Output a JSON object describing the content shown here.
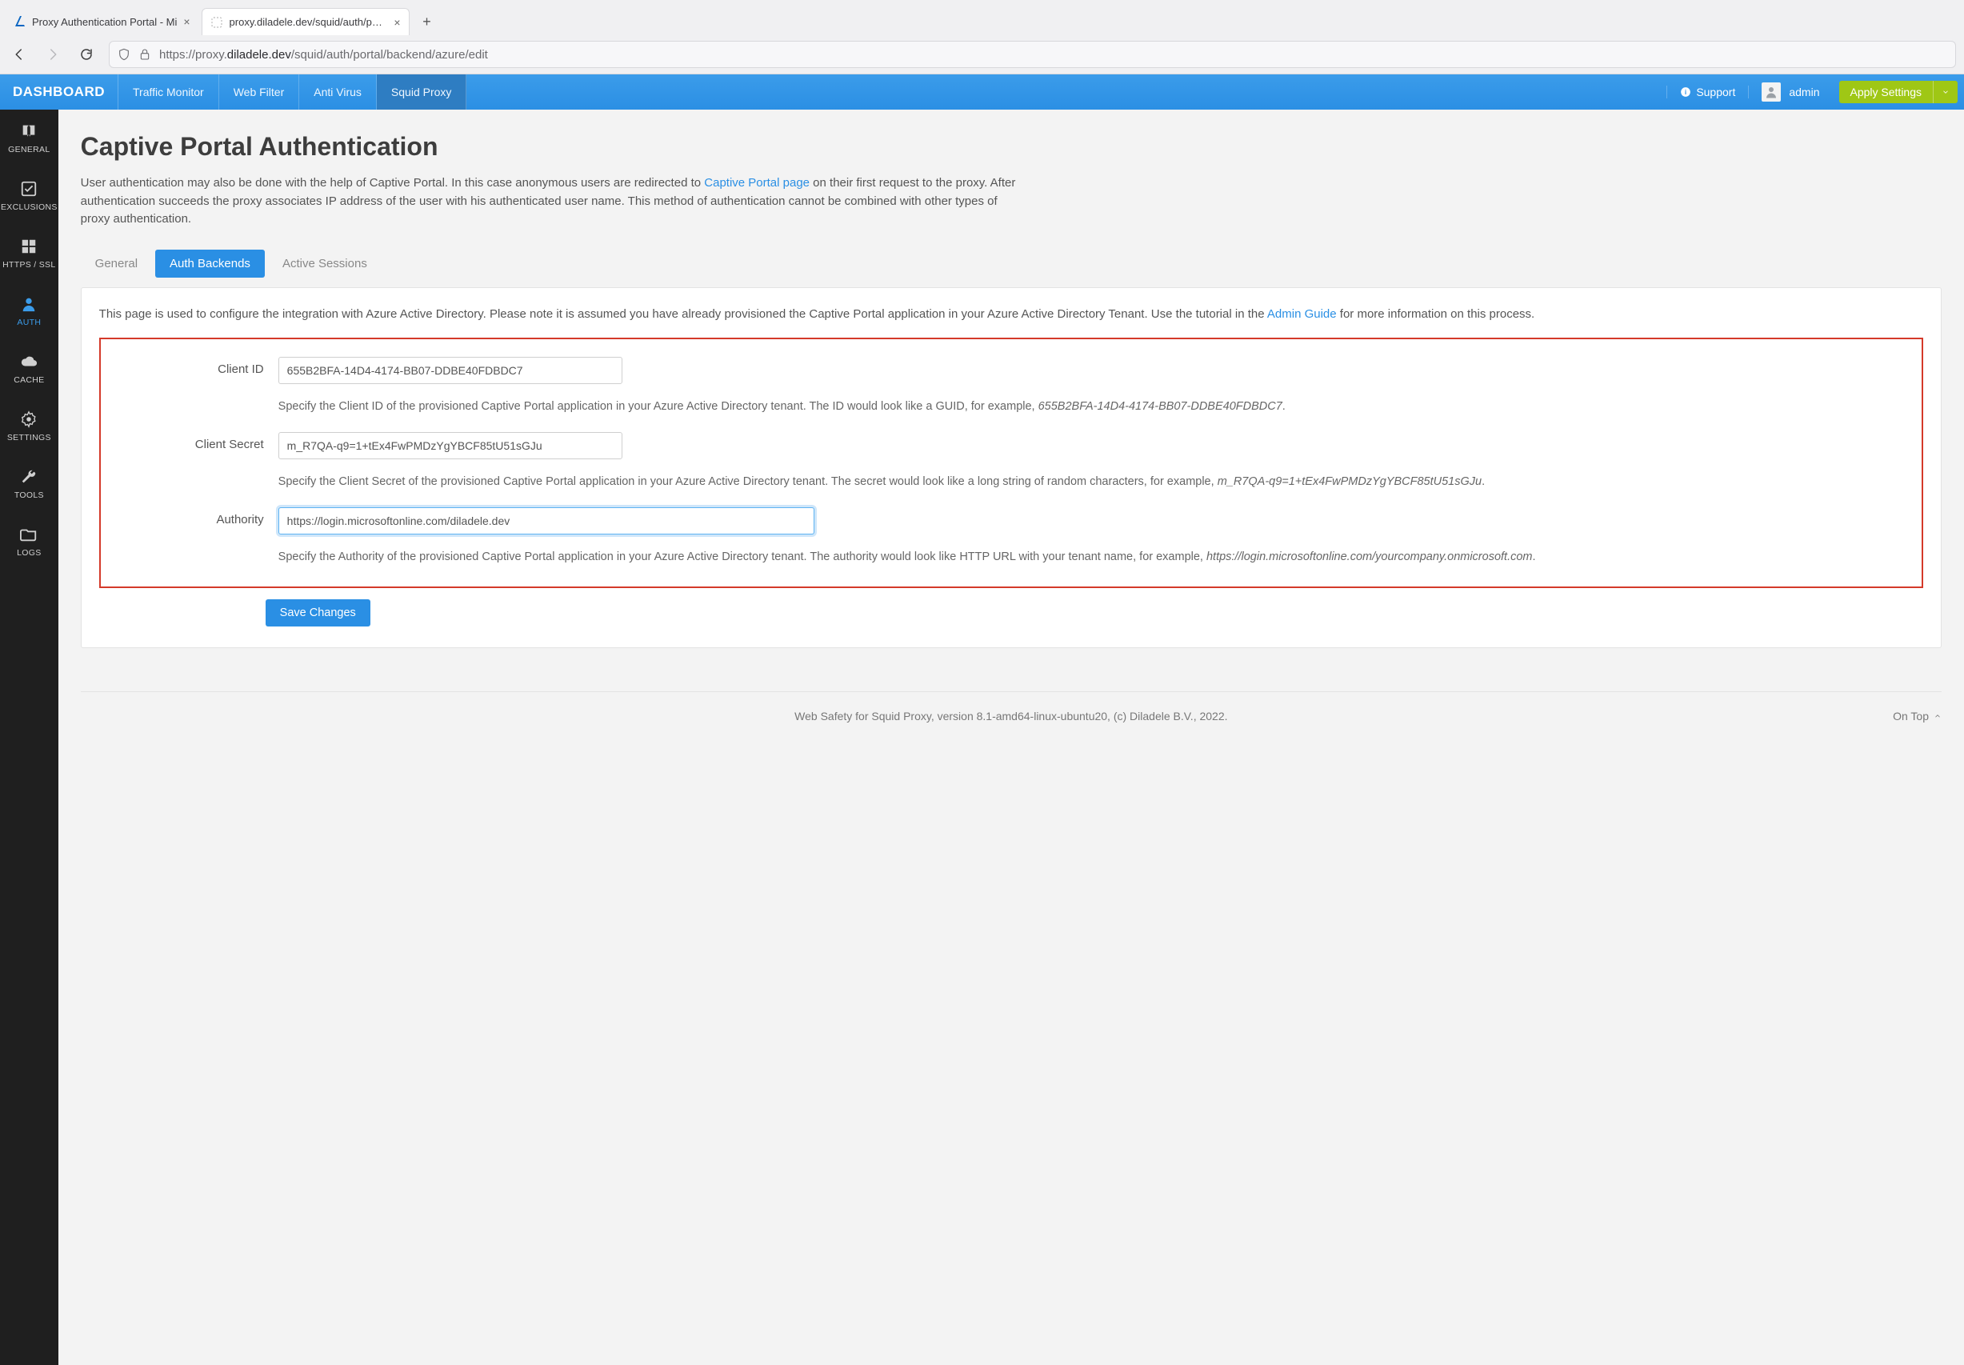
{
  "browser": {
    "tabs": [
      {
        "title": "Proxy Authentication Portal - Mi",
        "active": false,
        "fav": "azure"
      },
      {
        "title": "proxy.diladele.dev/squid/auth/porta",
        "active": true,
        "fav": "none"
      }
    ],
    "url_prefix": "https://proxy.",
    "url_host": "diladele.dev",
    "url_path": "/squid/auth/portal/backend/azure/edit"
  },
  "appbar": {
    "brand": "DASHBOARD",
    "nav": [
      "Traffic Monitor",
      "Web Filter",
      "Anti Virus",
      "Squid Proxy"
    ],
    "nav_active_index": 3,
    "support_label": "Support",
    "user_label": "admin",
    "apply_label": "Apply Settings"
  },
  "sidebar": {
    "items": [
      {
        "label": "GENERAL",
        "icon": "book"
      },
      {
        "label": "EXCLUSIONS",
        "icon": "check"
      },
      {
        "label": "HTTPS / SSL",
        "icon": "grid"
      },
      {
        "label": "AUTH",
        "icon": "user",
        "active": true
      },
      {
        "label": "CACHE",
        "icon": "cloud"
      },
      {
        "label": "SETTINGS",
        "icon": "gear"
      },
      {
        "label": "TOOLS",
        "icon": "wrench"
      },
      {
        "label": "LOGS",
        "icon": "folder"
      }
    ]
  },
  "page": {
    "title": "Captive Portal Authentication",
    "intro_pre": "User authentication may also be done with the help of Captive Portal. In this case anonymous users are redirected to ",
    "intro_link": "Captive Portal page",
    "intro_post": " on their first request to the proxy. After authentication succeeds the proxy associates IP address of the user with his authenticated user name. This method of authentication cannot be combined with other types of proxy authentication.",
    "tabs": [
      "General",
      "Auth Backends",
      "Active Sessions"
    ],
    "tabs_active_index": 1,
    "panel_intro_pre": "This page is used to configure the integration with Azure Active Directory. Please note it is assumed you have already provisioned the Captive Portal application in your Azure Active Directory Tenant. Use the tutorial in the ",
    "panel_intro_link": "Admin Guide",
    "panel_intro_post": " for more information on this process.",
    "fields": {
      "client_id": {
        "label": "Client ID",
        "value": "655B2BFA-14D4-4174-BB07-DDBE40FDBDC7",
        "help_pre": "Specify the Client ID of the provisioned Captive Portal application in your Azure Active Directory tenant. The ID would look like a GUID, for example, ",
        "help_em": "655B2BFA-14D4-4174-BB07-DDBE40FDBDC7",
        "help_post": "."
      },
      "client_secret": {
        "label": "Client Secret",
        "value": "m_R7QA-q9=1+tEx4FwPMDzYgYBCF85tU51sGJu",
        "help_pre": "Specify the Client Secret of the provisioned Captive Portal application in your Azure Active Directory tenant. The secret would look like a long string of random characters, for example, ",
        "help_em": "m_R7QA-q9=1+tEx4FwPMDzYgYBCF85tU51sGJu",
        "help_post": "."
      },
      "authority": {
        "label": "Authority",
        "value": "https://login.microsoftonline.com/diladele.dev",
        "help_pre": "Specify the Authority of the provisioned Captive Portal application in your Azure Active Directory tenant. The authority would look like HTTP URL with your tenant name, for example, ",
        "help_em": "https://login.microsoftonline.com/yourcompany.onmicrosoft.com",
        "help_post": "."
      }
    },
    "save_label": "Save Changes",
    "footer_text": "Web Safety for Squid Proxy, version 8.1-amd64-linux-ubuntu20, (c) Diladele B.V., 2022.",
    "ontop_label": "On Top"
  }
}
